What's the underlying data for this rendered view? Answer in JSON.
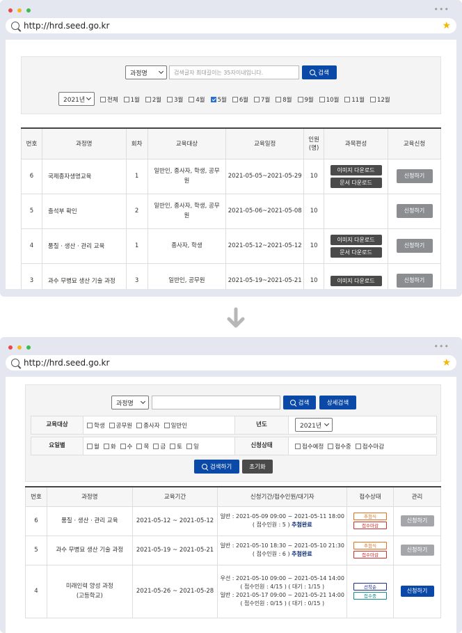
{
  "browser": {
    "url": "http://hrd.seed.go.kr",
    "dot_colors": [
      "#e9474a",
      "#f4b625",
      "#3fb950"
    ]
  },
  "before": {
    "search": {
      "category": "과정명",
      "placeholder": "검색글자 최대길이는 35자이내입니다.",
      "button": "검색",
      "year": "2021년",
      "months": [
        {
          "label": "전체",
          "checked": false
        },
        {
          "label": "1월",
          "checked": false
        },
        {
          "label": "2월",
          "checked": false
        },
        {
          "label": "3월",
          "checked": false
        },
        {
          "label": "4월",
          "checked": false
        },
        {
          "label": "5월",
          "checked": true
        },
        {
          "label": "6월",
          "checked": false
        },
        {
          "label": "7월",
          "checked": false
        },
        {
          "label": "8월",
          "checked": false
        },
        {
          "label": "9월",
          "checked": false
        },
        {
          "label": "10월",
          "checked": false
        },
        {
          "label": "11월",
          "checked": false
        },
        {
          "label": "12월",
          "checked": false
        }
      ]
    },
    "table": {
      "headers": [
        "번호",
        "과정명",
        "회차",
        "교육대상",
        "교육일정",
        "인원\n(명)",
        "과목편성",
        "교육신청"
      ],
      "rows": [
        {
          "no": "6",
          "name": "국제종자생명교육",
          "round": "1",
          "target": "일반인, 종사자, 학생, 공무원",
          "schedule": "2021-05-05~2021-05-29",
          "count": "10",
          "downloads": [
            "이미지 다운로드",
            "문서 다운로드"
          ],
          "apply": "신청하기"
        },
        {
          "no": "5",
          "name": "출석부 확인",
          "round": "2",
          "target": "일반인, 종사자, 학생, 공무원",
          "schedule": "2021-05-06~2021-05-08",
          "count": "10",
          "downloads": [],
          "apply": "신청하기"
        },
        {
          "no": "4",
          "name": "품질 · 생산 · 관리 교육",
          "round": "1",
          "target": "종사자, 학생",
          "schedule": "2021-05-12~2021-05-12",
          "count": "10",
          "downloads": [
            "이미지 다운로드",
            "문서 다운로드"
          ],
          "apply": "신청하기"
        },
        {
          "no": "3",
          "name": "과수 무병묘 생산 기술 과정",
          "round": "3",
          "target": "일반인, 공무원",
          "schedule": "2021-05-19~2021-05-21",
          "count": "10",
          "downloads": [
            "이미지 다운로드"
          ],
          "apply": "신청하기"
        }
      ]
    }
  },
  "after": {
    "search": {
      "category": "과정명",
      "button": "검색",
      "detail_button": "상세검색",
      "target_label": "교육대상",
      "targets": [
        "학생",
        "공무원",
        "종사자",
        "일반인"
      ],
      "year_label": "년도",
      "year": "2021년",
      "weekday_label": "요일별",
      "weekdays": [
        "월",
        "화",
        "수",
        "목",
        "금",
        "토",
        "일"
      ],
      "status_label": "신청상태",
      "statuses": [
        "접수예정",
        "접수중",
        "접수마감"
      ],
      "search_button": "검색하기",
      "reset_button": "초기화"
    },
    "table": {
      "headers": [
        "번호",
        "과정명",
        "교육기간",
        "신청기간/접수인원/대기자",
        "접수상태",
        "관리"
      ],
      "rows": [
        {
          "no": "6",
          "name": "품질 · 생산 · 관리 교육",
          "period": "2021-05-12 ~ 2021-05-12",
          "lines": [
            {
              "text": "일반 : 2021-05-09 09:00 ~ 2021-05-11 18:00"
            },
            {
              "text": "( 접수인원 : 5 ) ",
              "strong": "추첨완료"
            }
          ],
          "tags": [
            {
              "label": "추첨식",
              "tone": "orange"
            },
            {
              "label": "접수마감",
              "tone": "red"
            }
          ],
          "action": "신청하기",
          "action_active": false
        },
        {
          "no": "5",
          "name": "과수 무병묘 생산 기술 과정",
          "period": "2021-05-19 ~ 2021-05-21",
          "lines": [
            {
              "text": "일반 : 2021-05-10 18:30 ~ 2021-05-10 21:30"
            },
            {
              "text": "( 접수인원 : 6 ) ",
              "strong": "추첨완료"
            }
          ],
          "tags": [
            {
              "label": "추첨식",
              "tone": "orange"
            },
            {
              "label": "접수마감",
              "tone": "red"
            }
          ],
          "action": "신청하기",
          "action_active": false
        },
        {
          "no": "4",
          "name": "미래인력 양성 과정\n(고등학교)",
          "period": "2021-05-26 ~ 2021-05-28",
          "lines": [
            {
              "text": "우선 : 2021-05-10 09:00 ~ 2021-05-14 14:00"
            },
            {
              "text": "( 접수인원 : 4/15 ) ( 대기 : 1/15 )"
            },
            {
              "text": "일반 : 2021-05-17 09:00 ~ 2021-05-21 14:00"
            },
            {
              "text": "( 접수인원 : 0/15 ) ( 대기 : 0/15 )"
            }
          ],
          "tags": [
            {
              "label": "선착순",
              "tone": "navy"
            },
            {
              "label": "접수중",
              "tone": "teal"
            }
          ],
          "action": "신청하기",
          "action_active": true
        }
      ]
    }
  },
  "colors": {
    "primary_blue": "#0b49a8",
    "arrow": "#b7b7b7",
    "download_btn": "#4a4a4a",
    "apply_btn": "#8b8d91"
  }
}
